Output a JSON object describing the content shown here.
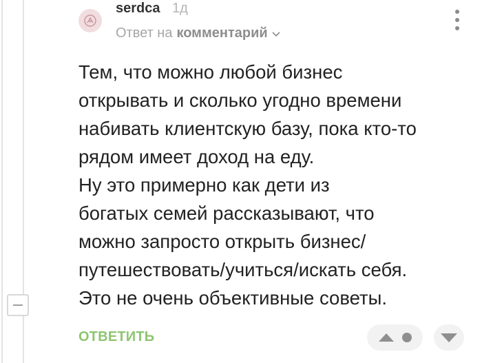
{
  "comment": {
    "author": "serdca",
    "time_ago": "1д",
    "reply_prefix": "Ответ на",
    "reply_target": "комментарий",
    "body_lines": [
      "Тем, что можно любой бизнес",
      "открывать и сколько угодно времени",
      "набивать клиентскую базу, пока кто-то",
      "рядом имеет доход на еду.",
      "Ну это примерно как дети из",
      "богатых семей рассказывают, что",
      "можно запросто открыть бизнес/",
      "путешествовать/учиться/искать себя.",
      "Это не очень объективные советы."
    ],
    "reply_label": "ОТВЕТИТЬ"
  },
  "icons": {
    "avatar": "avatar-icon",
    "more": "more-vertical-icon",
    "chevron": "chevron-down-icon",
    "collapse": "minus-icon",
    "vote_up": "triangle-up-icon",
    "rating": "dot-icon",
    "vote_down": "triangle-down-icon"
  },
  "colors": {
    "accent_green": "#8dc56f",
    "text": "#222222",
    "muted": "#a6a6a6",
    "icon_gray": "#8f8f8f"
  }
}
